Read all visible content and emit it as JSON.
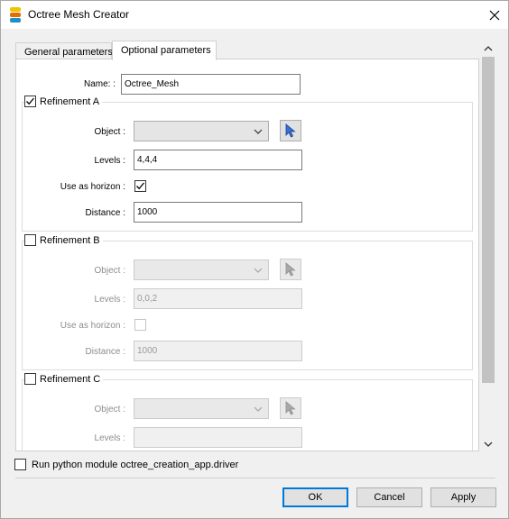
{
  "window": {
    "title": "Octree Mesh Creator"
  },
  "icons": {
    "app": "layers-app-icon",
    "close": "close-icon",
    "pick": "cursor-pick-icon"
  },
  "tabs": [
    {
      "label": "General parameters",
      "active": false
    },
    {
      "label": "Optional parameters",
      "active": true
    }
  ],
  "form": {
    "name_label": "Name: :",
    "name_value": "Octree_Mesh"
  },
  "refinements": [
    {
      "title": "Refinement A",
      "checked": true,
      "enabled": true,
      "object_label": "Object :",
      "object_value": "",
      "levels_label": "Levels :",
      "levels_value": "4,4,4",
      "horizon_label": "Use as horizon :",
      "horizon_checked": true,
      "distance_label": "Distance :",
      "distance_value": "1000"
    },
    {
      "title": "Refinement B",
      "checked": false,
      "enabled": false,
      "object_label": "Object :",
      "object_value": "",
      "levels_label": "Levels :",
      "levels_value": "0,0,2",
      "horizon_label": "Use as horizon :",
      "horizon_checked": false,
      "distance_label": "Distance :",
      "distance_value": "1000"
    },
    {
      "title": "Refinement C",
      "checked": false,
      "enabled": false,
      "object_label": "Object :",
      "object_value": "",
      "levels_label": "Levels :",
      "levels_value": ""
    }
  ],
  "footer": {
    "run_python_label": "Run python module octree_creation_app.driver",
    "run_python_checked": false,
    "ok_label": "OK",
    "cancel_label": "Cancel",
    "apply_label": "Apply"
  },
  "colors": {
    "accent": "#0078d7",
    "pick_icon": "#3a6fd8"
  }
}
